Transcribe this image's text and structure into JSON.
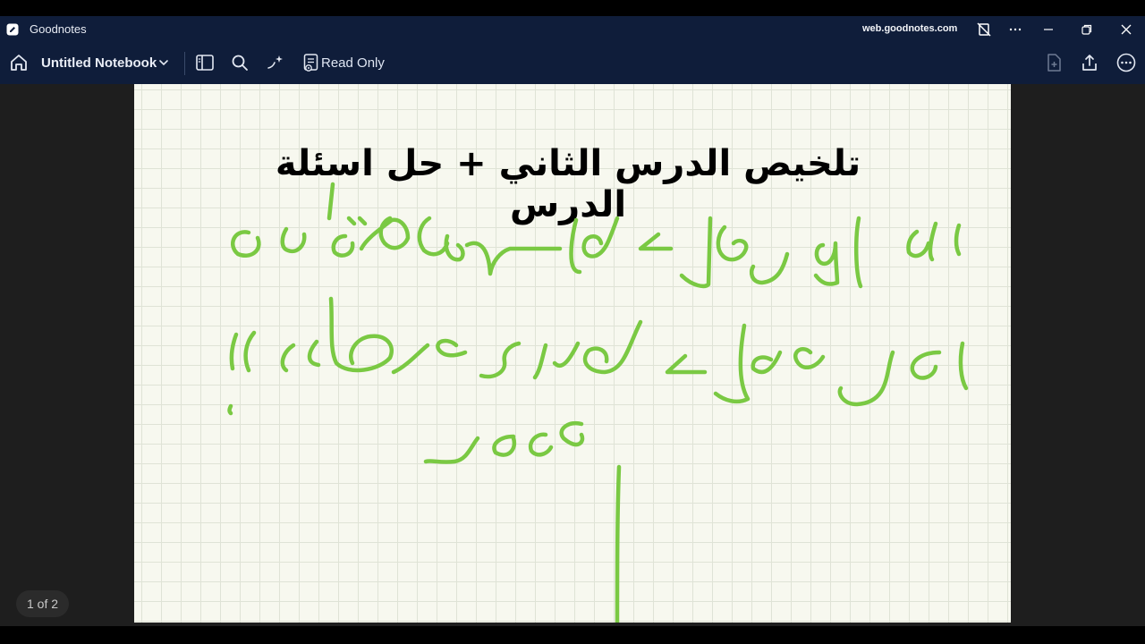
{
  "window": {
    "app_name": "Goodnotes",
    "url": "web.goodnotes.com"
  },
  "toolbar": {
    "notebook_title": "Untitled Notebook",
    "read_only_label": "Read Only"
  },
  "page": {
    "heading": "تلخيص الدرس الثاني + حل اسئلة الدرس",
    "counter": "1 of 2"
  },
  "colors": {
    "chrome": "#0f1d3a",
    "ink_green": "#7ac943",
    "paper": "#f7f8ef",
    "grid": "#dfe3d6"
  },
  "icons": [
    "app-logo-icon",
    "home-icon",
    "chevron-down-icon",
    "sidebar-icon",
    "search-icon",
    "ai-sparkle-icon",
    "read-only-icon",
    "no-screenshot-icon",
    "more-horizontal-icon",
    "minimize-icon",
    "restore-icon",
    "close-icon",
    "add-page-icon",
    "share-icon",
    "more-circle-icon"
  ]
}
